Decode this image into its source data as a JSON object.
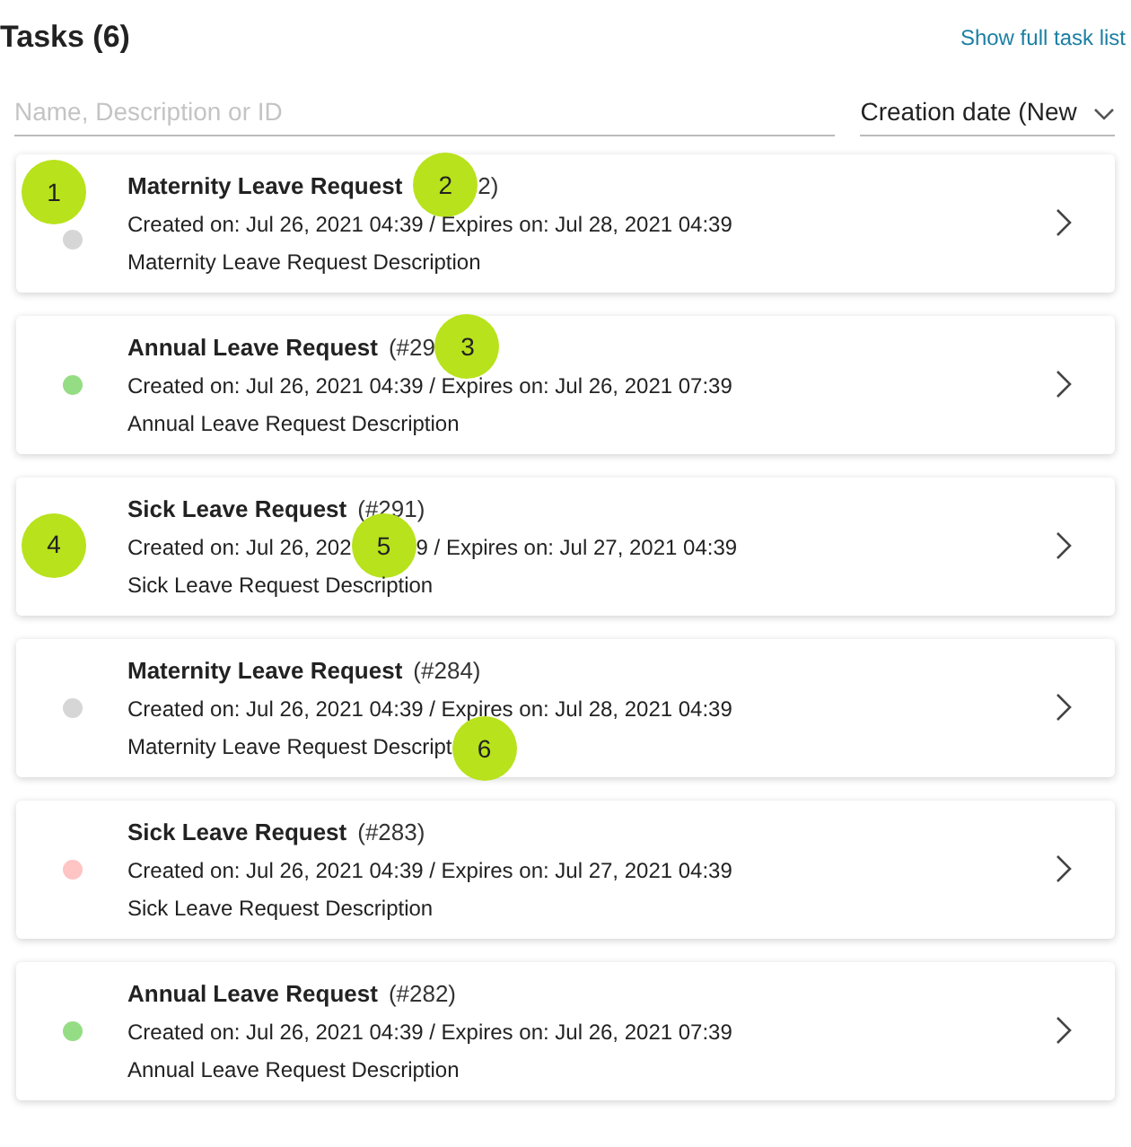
{
  "header": {
    "title": "Tasks (6)",
    "link": "Show full task list"
  },
  "search": {
    "placeholder": "Name, Description or ID"
  },
  "sort": {
    "value": "Creation date (New"
  },
  "tasks": [
    {
      "markers": [
        {
          "kind": "callout",
          "label": "1"
        },
        {
          "kind": "dot",
          "color": "#d6d6d6"
        }
      ],
      "title": [
        {
          "kind": "name",
          "text": "Maternity Leave Request"
        },
        {
          "kind": "callout",
          "label": "2"
        },
        {
          "kind": "id",
          "text": "2)"
        }
      ],
      "meta": [
        {
          "kind": "text",
          "text": "Created on: Jul 26, 2021 04:39 / Expires on: Jul 28, 2021 04:39"
        }
      ],
      "description": [
        {
          "kind": "text",
          "text": "Maternity Leave Request Description"
        }
      ]
    },
    {
      "markers": [
        {
          "kind": "dot",
          "color": "#95dd84"
        }
      ],
      "title": [
        {
          "kind": "name",
          "text": "Annual Leave Request"
        },
        {
          "kind": "id",
          "text": "(#29"
        },
        {
          "kind": "callout",
          "label": "3"
        }
      ],
      "meta": [
        {
          "kind": "text",
          "text": "Created on: Jul 26, 2021 04:39 / Expires on: Jul 26, 2021 07:39"
        }
      ],
      "description": [
        {
          "kind": "text",
          "text": "Annual Leave Request Description"
        }
      ]
    },
    {
      "markers": [
        {
          "kind": "callout",
          "label": "4"
        }
      ],
      "title": [
        {
          "kind": "name",
          "text": "Sick Leave Request"
        },
        {
          "kind": "id",
          "text": "(#291)"
        }
      ],
      "meta": [
        {
          "kind": "text",
          "text": "Created on: Jul 26, 202"
        },
        {
          "kind": "callout",
          "label": "5"
        },
        {
          "kind": "text",
          "text": "9 / Expires on: Jul 27, 2021 04:39"
        }
      ],
      "description": [
        {
          "kind": "text",
          "text": "Sick Leave Request Description"
        }
      ]
    },
    {
      "markers": [
        {
          "kind": "dot",
          "color": "#d6d6d6"
        }
      ],
      "title": [
        {
          "kind": "name",
          "text": "Maternity Leave Request"
        },
        {
          "kind": "id",
          "text": "(#284)"
        }
      ],
      "meta": [
        {
          "kind": "text",
          "text": "Created on: Jul 26, 2021 04:39 / Expires on: Jul 28, 2021 04:39"
        }
      ],
      "description": [
        {
          "kind": "text",
          "text": "Maternity Leave Request Descript"
        },
        {
          "kind": "callout",
          "label": "6"
        }
      ]
    },
    {
      "markers": [
        {
          "kind": "dot",
          "color": "#ffc4c4"
        }
      ],
      "title": [
        {
          "kind": "name",
          "text": "Sick Leave Request"
        },
        {
          "kind": "id",
          "text": "(#283)"
        }
      ],
      "meta": [
        {
          "kind": "text",
          "text": "Created on: Jul 26, 2021 04:39 / Expires on: Jul 27, 2021 04:39"
        }
      ],
      "description": [
        {
          "kind": "text",
          "text": "Sick Leave Request Description"
        }
      ]
    },
    {
      "markers": [
        {
          "kind": "dot",
          "color": "#95dd84"
        }
      ],
      "title": [
        {
          "kind": "name",
          "text": "Annual Leave Request"
        },
        {
          "kind": "id",
          "text": "(#282)"
        }
      ],
      "meta": [
        {
          "kind": "text",
          "text": "Created on: Jul 26, 2021 04:39 / Expires on: Jul 26, 2021 07:39"
        }
      ],
      "description": [
        {
          "kind": "text",
          "text": "Annual Leave Request Description"
        }
      ]
    }
  ]
}
